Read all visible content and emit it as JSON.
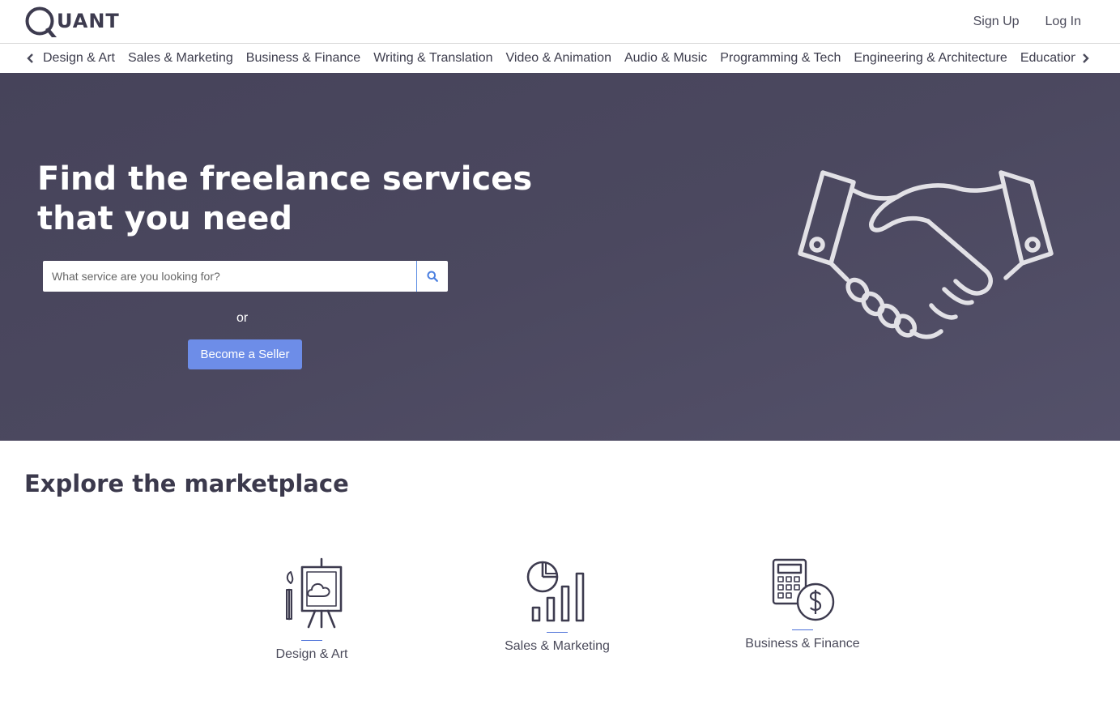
{
  "header": {
    "logo_text": "UANT",
    "sign_up": "Sign Up",
    "log_in": "Log In"
  },
  "categories": [
    "Design & Art",
    "Sales & Marketing",
    "Business & Finance",
    "Writing & Translation",
    "Video & Animation",
    "Audio & Music",
    "Programming & Tech",
    "Engineering & Architecture",
    "Education"
  ],
  "hero": {
    "title": "Find the freelance services that you need",
    "search_placeholder": "What service are you looking for?",
    "or_text": "or",
    "seller_button": "Become a Seller"
  },
  "explore": {
    "title": "Explore the marketplace",
    "cards": [
      {
        "label": "Design & Art",
        "icon": "easel-icon"
      },
      {
        "label": "Sales & Marketing",
        "icon": "chart-icon"
      },
      {
        "label": "Business & Finance",
        "icon": "calculator-icon"
      }
    ]
  },
  "colors": {
    "hero_bg": "#4b485f",
    "accent": "#6d8de8",
    "text_dark": "#3b394c"
  }
}
